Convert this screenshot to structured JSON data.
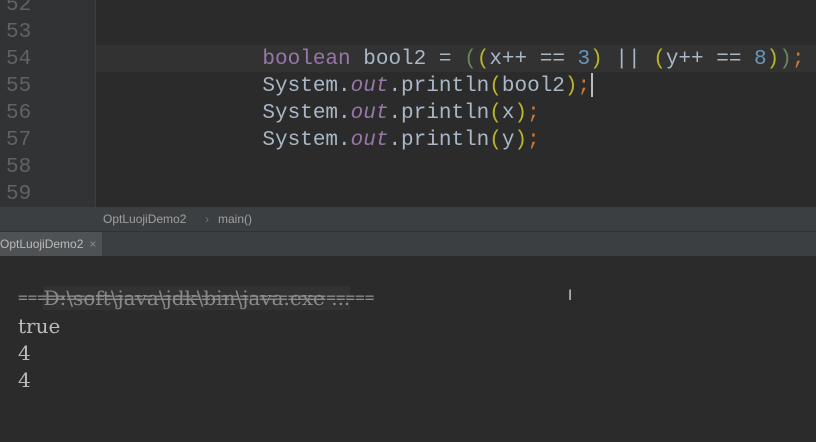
{
  "editor": {
    "line_numbers": [
      "52",
      "53",
      "54",
      "55",
      "56",
      "57",
      "58",
      "59"
    ],
    "lines": {
      "l53": {
        "kw": "boolean",
        "var": "bool2",
        "eq": "=",
        "p1": "(",
        "p2": "(",
        "xexpr": "x++ ==",
        "n3": "3",
        "p3": ")",
        "or": "||",
        "p4": "(",
        "yexpr": "y++ ==",
        "n8": "8",
        "p5": ")",
        "p6": ")",
        "semi": ";"
      },
      "l54": {
        "sys": "System.",
        "out": "out",
        "call": ".println",
        "po": "(",
        "arg": "bool2",
        "pc": ")",
        "semi": ";"
      },
      "l55": {
        "sys": "System.",
        "out": "out",
        "call": ".println",
        "po": "(",
        "arg": "x",
        "pc": ")",
        "semi": ";"
      },
      "l56": {
        "sys": "System.",
        "out": "out",
        "call": ".println",
        "po": "(",
        "arg": "y",
        "pc": ")",
        "semi": ";"
      }
    }
  },
  "breadcrumb": {
    "class_name": "OptLuojiDemo2",
    "separator": "›",
    "method": "main()"
  },
  "run_tab": {
    "label": "OptLuojiDemo2",
    "close": "×"
  },
  "console": {
    "command": "D:\\soft\\java\\jdk\\bin\\java.exe ...",
    "separator": "=====================================",
    "output": [
      "true",
      "4",
      "4"
    ]
  }
}
